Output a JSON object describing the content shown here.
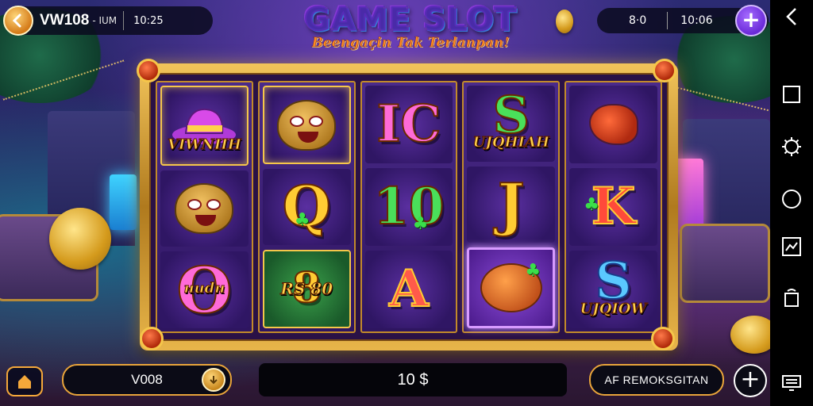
{
  "top_bar": {
    "account_id": "VW108",
    "account_sub": "- IUM",
    "balance_small": "10:25",
    "stat_a": "8⋅0",
    "stat_b": "10:06",
    "add_symbol": "+"
  },
  "title": {
    "main": "GAME SLOT",
    "subtitle": "Beengaçin Tak Terlanpan!"
  },
  "reels": [
    {
      "cells": [
        {
          "kind": "hat",
          "label": "VIWNIIH"
        },
        {
          "kind": "face"
        },
        {
          "kind": "letter",
          "text": "O",
          "color": "pink",
          "label": "ниdн"
        }
      ]
    },
    {
      "cells": [
        {
          "kind": "face"
        },
        {
          "kind": "letter",
          "text": "Q",
          "color": "gold"
        },
        {
          "kind": "letter",
          "text": "8",
          "color": "gold",
          "label": "RS 80"
        }
      ]
    },
    {
      "cells": [
        {
          "kind": "letter",
          "text": "IC",
          "color": "pink"
        },
        {
          "kind": "letter",
          "text": "10",
          "color": "green"
        },
        {
          "kind": "letter",
          "text": "A",
          "color": "red"
        }
      ]
    },
    {
      "cells": [
        {
          "kind": "letter",
          "text": "S",
          "color": "green",
          "label": "UJQHIAH"
        },
        {
          "kind": "letter",
          "text": "J",
          "color": "gold"
        },
        {
          "kind": "fruit"
        }
      ]
    },
    {
      "cells": [
        {
          "kind": "bird"
        },
        {
          "kind": "letter",
          "text": "K",
          "color": "red"
        },
        {
          "kind": "letter",
          "text": "S",
          "color": "blue",
          "label": "UJQIOW"
        }
      ]
    }
  ],
  "bottom_bar": {
    "bet_value": "V008",
    "win_amount": "10 $",
    "auto_label": "AF REMOKSGITAN",
    "add_symbol": "+"
  },
  "icons": {
    "home": "house-icon",
    "coin": "coin-icon",
    "back": "back-chevron-icon",
    "square": "square-icon",
    "gear": "gear-icon",
    "circle": "circle-icon",
    "screenshot": "screenshot-icon",
    "rotate": "rotate-icon",
    "keyboard": "keyboard-icon"
  },
  "colors": {
    "accent_gold": "#f5c64a",
    "accent_purple": "#6a2ad8",
    "bg_dark": "#2a1f5c"
  }
}
